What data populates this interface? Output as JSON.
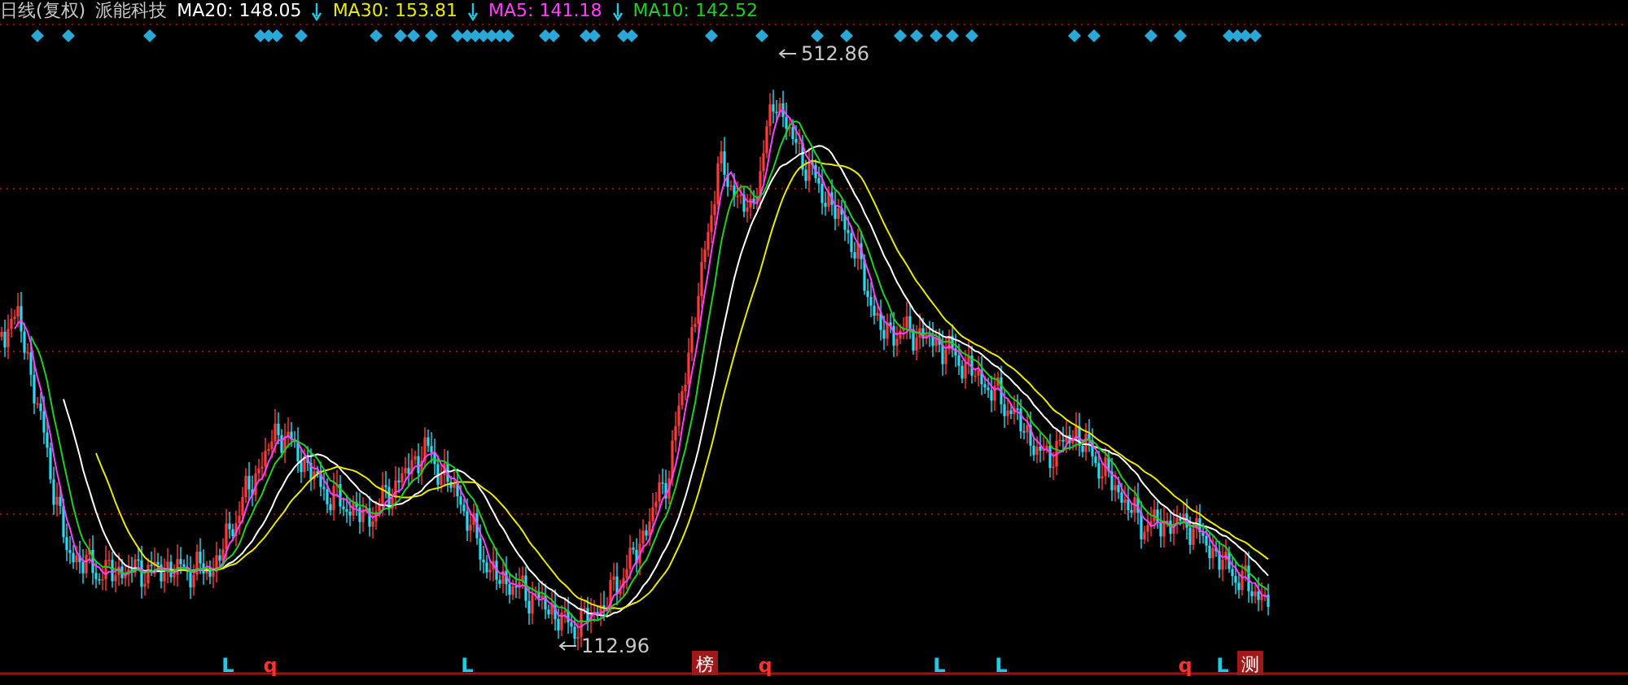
{
  "legend": {
    "title": "日线(复权)",
    "stock": "派能科技",
    "indicators": [
      {
        "label": "MA20: 148.05",
        "color": "#ffffff"
      },
      {
        "label": "MA30: 153.81",
        "color": "#e8e800"
      },
      {
        "label": "MA5: 141.18",
        "color": "#ff40ff"
      },
      {
        "label": "MA10: 142.52",
        "color": "#20d020"
      }
    ]
  },
  "chart": {
    "high_label": "512.86",
    "low_label": "112.96",
    "markers": [
      {
        "text": "L",
        "kind": "letter",
        "color": "#22c8e8"
      },
      {
        "text": "q",
        "kind": "letter",
        "color": "#ff3030"
      },
      {
        "text": "L",
        "kind": "letter",
        "color": "#22c8e8"
      },
      {
        "text": "榜",
        "kind": "tag",
        "color": "#a01818"
      },
      {
        "text": "q",
        "kind": "letter",
        "color": "#ff3030"
      },
      {
        "text": "L",
        "kind": "letter",
        "color": "#22c8e8"
      },
      {
        "text": "L",
        "kind": "letter",
        "color": "#22c8e8"
      },
      {
        "text": "q",
        "kind": "letter",
        "color": "#ff3030"
      },
      {
        "text": "L",
        "kind": "letter",
        "color": "#22c8e8"
      },
      {
        "text": "测",
        "kind": "tag",
        "color": "#a01818"
      }
    ]
  }
}
